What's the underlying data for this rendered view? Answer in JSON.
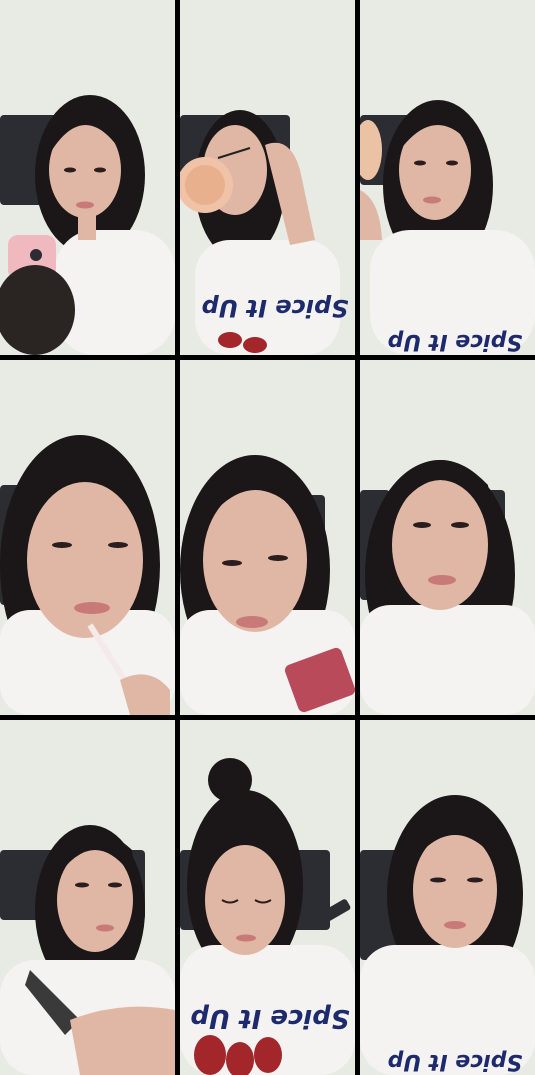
{
  "collage": {
    "rows": 3,
    "cols": 3,
    "divider_color": "#000000",
    "cells": [
      {
        "id": "frame-1",
        "scene": "holding-phone",
        "shirt_text": ""
      },
      {
        "id": "frame-2",
        "scene": "applying-powder",
        "shirt_text": "Spice It Up"
      },
      {
        "id": "frame-3",
        "scene": "holding-compact",
        "shirt_text": "Spice It Up"
      },
      {
        "id": "frame-4",
        "scene": "applying-lip-gloss",
        "shirt_text": ""
      },
      {
        "id": "frame-5",
        "scene": "holding-lipstick",
        "shirt_text": ""
      },
      {
        "id": "frame-6",
        "scene": "smiling",
        "shirt_text": ""
      },
      {
        "id": "frame-7",
        "scene": "holding-hair-tie",
        "shirt_text": ""
      },
      {
        "id": "frame-8",
        "scene": "hair-tied-up",
        "shirt_text": "Spice It Up"
      },
      {
        "id": "frame-9",
        "scene": "final-look",
        "shirt_text": "Spice It Up"
      }
    ]
  },
  "colors": {
    "wall": "#e7ebe3",
    "headboard": "#2b2d33",
    "skin": "#e0b7a4",
    "hair": "#1b1617",
    "shirt": "#f4f3f1",
    "lips": "#c87a78"
  }
}
